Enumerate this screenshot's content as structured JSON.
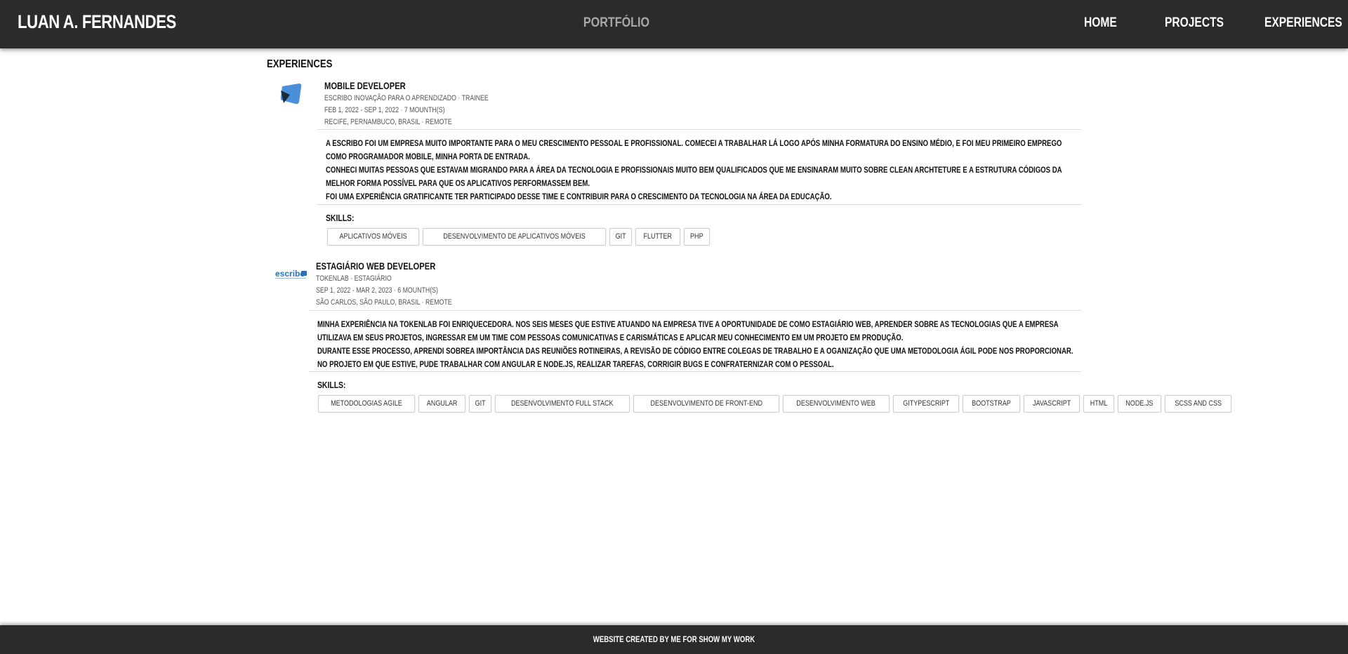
{
  "header": {
    "brand": "LUAN A. FERNANDES",
    "center_title": "PORTFÓLIO",
    "nav": [
      "HOME",
      "PROJECTS",
      "EXPERIENCES"
    ]
  },
  "section_title": "EXPERIENCES",
  "experiences": [
    {
      "logo": "scribo-logo",
      "role": "MOBILE DEVELOPER",
      "company": "ESCRIBO INOVAÇÃO PARA O APRENDIZADO · TRAINEE",
      "period": "FEB 1, 2022 - SEP 1, 2022 · 7 MOUNTH(S)",
      "location": "RECIFE, PERNAMBUCO, BRASIL · REMOTE",
      "description": [
        "A ESCRIBO FOI UM EMPRESA MUITO IMPORTANTE PARA O MEU CRESCIMENTO PESSOAL E PROFISSIONAL. COMECEI A TRABALHAR LÁ LOGO APÓS MINHA FORMATURA DO ENSINO MÉDIO, E FOI MEU PRIMEIRO EMPREGO COMO PROGRAMADOR MOBILE, MINHA PORTA DE ENTRADA.",
        "CONHECI MUITAS PESSOAS QUE ESTAVAM MIGRANDO PARA A ÁREA DA TECNOLOGIA E PROFISSIONAIS MUITO BEM QUALIFICADOS QUE ME ENSINARAM MUITO SOBRE CLEAN ARCHTETURE E A ESTRUTURA CÓDIGOS DA MELHOR FORMA POSSÍVEL PARA QUE OS APLICATIVOS PERFORMASSEM BEM.",
        "FOI UMA EXPERIÊNCIA GRATIFICANTE TER PARTICIPADO DESSE TIME E CONTRIBUIR PARA O CRESCIMENTO DA TECNOLOGIA NA ÁREA DA EDUCAÇÃO."
      ],
      "skills_label": "SKILLS:",
      "skills": [
        "APLICATIVOS MÓVEIS",
        "DESENVOLVIMENTO DE APLICATIVOS MÓVEIS",
        "GIT",
        "FLUTTER",
        "PHP"
      ]
    },
    {
      "logo": "escribo-logo",
      "logo_text": "escribo",
      "role": "ESTAGIÁRIO WEB DEVELOPER",
      "company": "TOKENLAB · ESTAGIÁRIO",
      "period": "SEP 1, 2022 - MAR 2, 2023 · 6 MOUNTH(S)",
      "location": "SÃO CARLOS, SÃO PAULO, BRASIL · REMOTE",
      "description": [
        "MINHA EXPERIÊNCIA NA TOKENLAB FOI ENRIQUECEDORA. NOS SEIS MESES QUE ESTIVE ATUANDO NA EMPRESA TIVE A OPORTUNIDADE DE COMO ESTAGIÁRIO WEB, APRENDER SOBRE AS TECNOLOGIAS QUE A EMPRESA UTILIZAVA EM SEUS PROJETOS, INGRESSAR EM UM TIME COM PESSOAS COMUNICATIVAS E CARISMÁTICAS E APLICAR MEU CONHECIMENTO EM UM PROJETO EM PRODUÇÃO.",
        "DURANTE ESSE PROCESSO, APRENDI SOBREA IMPORTÂNCIA DAS REUNIÕES ROTINEIRAS, A REVISÃO DE CÓDIGO ENTRE COLEGAS DE TRABALHO E A OGANIZAÇÃO QUE UMA METODOLOGIA ÁGIL PODE NOS PROPORCIONAR.",
        "NO PROJETO EM QUE ESTIVE, PUDE TRABALHAR COM ANGULAR E NODE.JS, REALIZAR TAREFAS, CORRIGIR BUGS E CONFRATERNIZAR COM O PESSOAL."
      ],
      "skills_label": "SKILLS:",
      "skills": [
        "METODOLOGIAS AGILE",
        "ANGULAR",
        "GIT",
        "DESENVOLVIMENTO FULL STACK",
        "DESENVOLVIMENTO DE FRONT-END",
        "DESENVOLVIMENTO WEB",
        "GITYPESCRIPT",
        "BOOTSTRAP",
        "JAVASCRIPT",
        "HTML",
        "NODE.JS",
        "SCSS AND CSS"
      ]
    }
  ],
  "footer": {
    "text": "WEBSITE CREATED BY ME FOR SHOW MY WORK"
  },
  "colors": {
    "bar": "#2b2b2b",
    "center_title": "#a8a8a8",
    "logo_blue": "#4a90d9",
    "logo_dark": "#1d2a3a"
  }
}
